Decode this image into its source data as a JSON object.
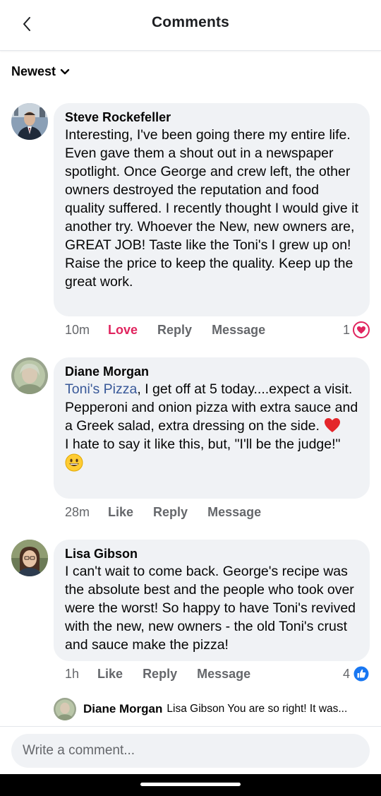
{
  "header": {
    "title": "Comments"
  },
  "sort": {
    "label": "Newest"
  },
  "comments": [
    {
      "author": "Steve Rockefeller",
      "text": "Interesting, I've been going there my entire life. Even gave them a shout out in a newspaper spotlight. Once George and crew left, the other owners destroyed the reputation and food quality suffered. I recently thought I would give it another try. Whoever the New, new owners are, GREAT JOB! Taste like the Toni's I grew up on! Raise the price to keep the quality. Keep up the great work.",
      "time": "10m",
      "reaction_label": "Love",
      "reply_label": "Reply",
      "message_label": "Message",
      "reaction_count": "1",
      "reaction_icon": "heart-icon"
    },
    {
      "author": "Diane Morgan",
      "mention": "Toni's Pizza",
      "text_line1": ", I get off at 5 today....expect a visit. Pepperoni and onion pizza with extra sauce and a Greek salad, extra dressing on the side.",
      "text_line2": "I hate to say it like this, but, \"I'll be the judge!\"",
      "time": "28m",
      "reaction_label": "Like",
      "reply_label": "Reply",
      "message_label": "Message"
    },
    {
      "author": "Lisa Gibson",
      "text": "I can't wait to come back. George's recipe was the absolute best and the people who took over were the worst! So happy to have Toni's revived with the new, new owners - the old Toni's crust and sauce make the pizza!",
      "time": "1h",
      "reaction_label": "Like",
      "reply_label": "Reply",
      "message_label": "Message",
      "reaction_count": "4",
      "reaction_icon": "like-icon"
    }
  ],
  "reply_preview": {
    "author": "Diane Morgan",
    "text": "Lisa Gibson You are so right! It was..."
  },
  "composer": {
    "placeholder": "Write a comment..."
  },
  "colors": {
    "love": "#e0245e",
    "like": "#1877f2",
    "bubble": "#f0f2f5",
    "muted": "#65676b"
  }
}
